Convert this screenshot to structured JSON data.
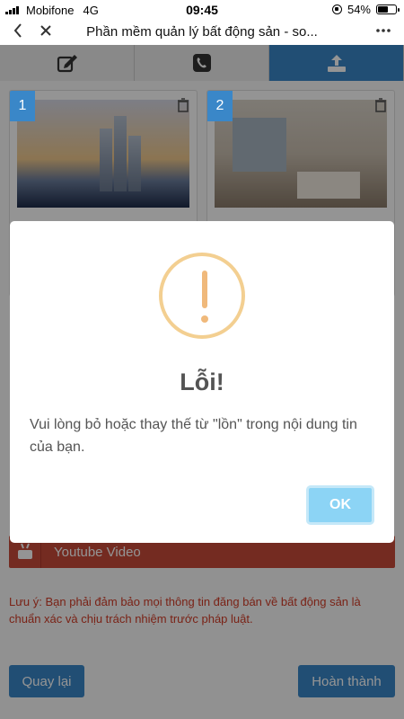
{
  "status_bar": {
    "carrier": "Mobifone",
    "network": "4G",
    "time": "09:45",
    "battery": "54%"
  },
  "browser": {
    "title": "Phần mềm quản lý bất động sản - so...",
    "back_icon": "chevron-left-icon",
    "close_icon": "close-icon",
    "more_icon": "more-icon"
  },
  "steps": [
    {
      "icon": "edit-icon",
      "active": false
    },
    {
      "icon": "phone-icon",
      "active": false
    },
    {
      "icon": "upload-icon",
      "active": true
    }
  ],
  "images": [
    {
      "number": "1"
    },
    {
      "number": "2"
    }
  ],
  "video": {
    "label": "Youtube Video"
  },
  "note": "Lưu ý: Bạn phải đảm bảo mọi thông tin đăng bán về bất động sản là chuẩn xác và chịu trách nhiệm trước pháp luật.",
  "buttons": {
    "back": "Quay lại",
    "done": "Hoàn thành"
  },
  "modal": {
    "title": "Lỗi!",
    "message": "Vui lòng bỏ hoặc thay thế từ \"lồn\" trong nội dung tin của bạn.",
    "ok": "OK"
  },
  "colors": {
    "accent": "#3a87c8",
    "warning": "#f0b97b",
    "ok_button": "#8cd4f5",
    "note_text": "#d23b26",
    "video_bg": "#c84a3a"
  }
}
